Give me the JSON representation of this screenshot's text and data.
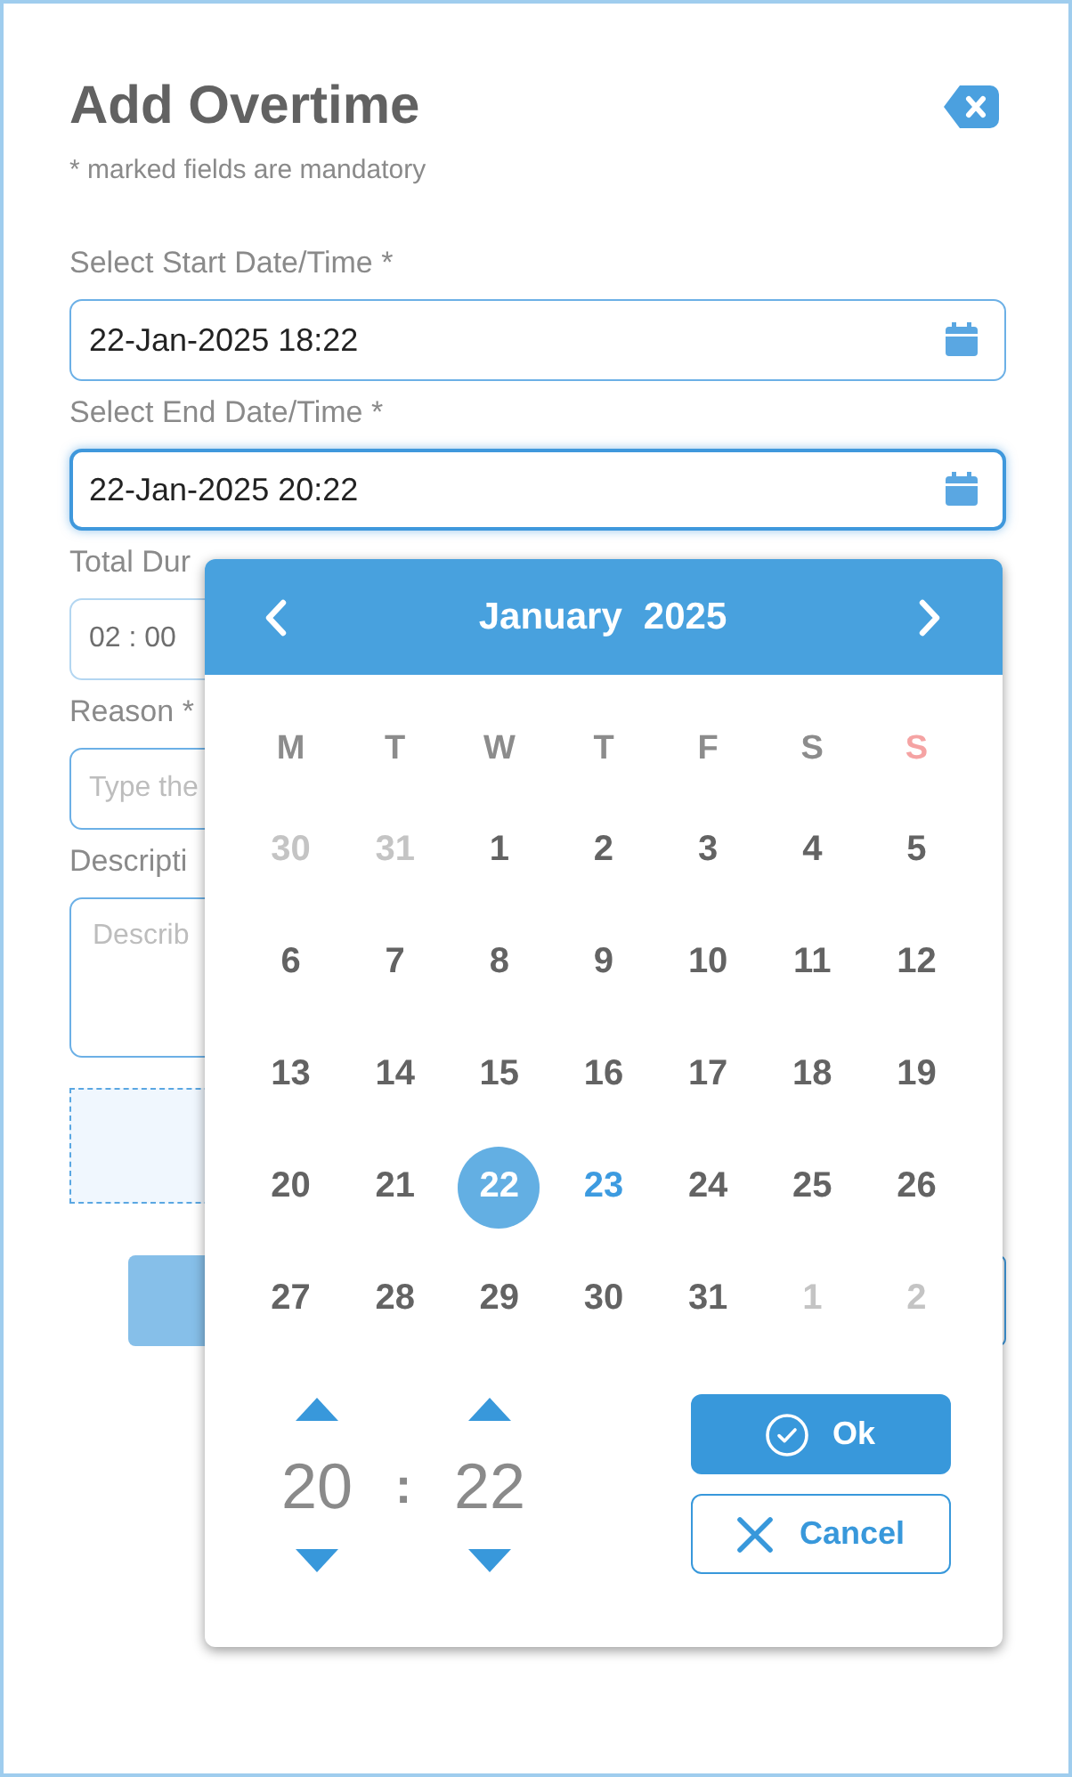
{
  "dialog": {
    "title": "Add Overtime",
    "note": "* marked fields are mandatory"
  },
  "fields": [
    {
      "kind": "date",
      "label": "Select Start Date/Time *",
      "value": "22-Jan-2025 18:22",
      "focused": false,
      "disabled": false
    },
    {
      "kind": "date",
      "label": "Select End Date/Time *",
      "value": "22-Jan-2025 20:22",
      "focused": true,
      "disabled": false
    },
    {
      "kind": "text",
      "label": "Total Dur",
      "value": "02 : 00",
      "focused": false,
      "disabled": true
    },
    {
      "kind": "text",
      "label": "Reason *",
      "placeholder": "Type the",
      "focused": false,
      "disabled": false
    },
    {
      "kind": "textarea",
      "label": "Descripti",
      "placeholder": "Describ",
      "focused": false,
      "disabled": false
    }
  ],
  "drop_zone": true,
  "buttons": [
    {
      "kind": "filled"
    },
    {
      "kind": "outline"
    }
  ],
  "date_picker": {
    "month": "January",
    "year": "2025",
    "weekdays": [
      {
        "label": "M",
        "color": "#8c8c8c"
      },
      {
        "label": "T",
        "color": "#8c8c8c"
      },
      {
        "label": "W",
        "color": "#8c8c8c"
      },
      {
        "label": "T",
        "color": "#8c8c8c"
      },
      {
        "label": "F",
        "color": "#8c8c8c"
      },
      {
        "label": "S",
        "color": "#8c8c8c"
      },
      {
        "label": "S",
        "color": "#f5a3a3"
      }
    ],
    "weeks": [
      [
        {
          "day": "30",
          "outside": true,
          "selected": false,
          "today": false
        },
        {
          "day": "31",
          "outside": true,
          "selected": false,
          "today": false
        },
        {
          "day": "1",
          "outside": false,
          "selected": false,
          "today": false
        },
        {
          "day": "2",
          "outside": false,
          "selected": false,
          "today": false
        },
        {
          "day": "3",
          "outside": false,
          "selected": false,
          "today": false
        },
        {
          "day": "4",
          "outside": false,
          "selected": false,
          "today": false
        },
        {
          "day": "5",
          "outside": false,
          "selected": false,
          "today": false
        }
      ],
      [
        {
          "day": "6",
          "outside": false,
          "selected": false,
          "today": false
        },
        {
          "day": "7",
          "outside": false,
          "selected": false,
          "today": false
        },
        {
          "day": "8",
          "outside": false,
          "selected": false,
          "today": false
        },
        {
          "day": "9",
          "outside": false,
          "selected": false,
          "today": false
        },
        {
          "day": "10",
          "outside": false,
          "selected": false,
          "today": false
        },
        {
          "day": "11",
          "outside": false,
          "selected": false,
          "today": false
        },
        {
          "day": "12",
          "outside": false,
          "selected": false,
          "today": false
        }
      ],
      [
        {
          "day": "13",
          "outside": false,
          "selected": false,
          "today": false
        },
        {
          "day": "14",
          "outside": false,
          "selected": false,
          "today": false
        },
        {
          "day": "15",
          "outside": false,
          "selected": false,
          "today": false
        },
        {
          "day": "16",
          "outside": false,
          "selected": false,
          "today": false
        },
        {
          "day": "17",
          "outside": false,
          "selected": false,
          "today": false
        },
        {
          "day": "18",
          "outside": false,
          "selected": false,
          "today": false
        },
        {
          "day": "19",
          "outside": false,
          "selected": false,
          "today": false
        }
      ],
      [
        {
          "day": "20",
          "outside": false,
          "selected": false,
          "today": false
        },
        {
          "day": "21",
          "outside": false,
          "selected": false,
          "today": false
        },
        {
          "day": "22",
          "outside": false,
          "selected": true,
          "today": false
        },
        {
          "day": "23",
          "outside": false,
          "selected": false,
          "today": true
        },
        {
          "day": "24",
          "outside": false,
          "selected": false,
          "today": false
        },
        {
          "day": "25",
          "outside": false,
          "selected": false,
          "today": false
        },
        {
          "day": "26",
          "outside": false,
          "selected": false,
          "today": false
        }
      ],
      [
        {
          "day": "27",
          "outside": false,
          "selected": false,
          "today": false
        },
        {
          "day": "28",
          "outside": false,
          "selected": false,
          "today": false
        },
        {
          "day": "29",
          "outside": false,
          "selected": false,
          "today": false
        },
        {
          "day": "30",
          "outside": false,
          "selected": false,
          "today": false
        },
        {
          "day": "31",
          "outside": false,
          "selected": false,
          "today": false
        },
        {
          "day": "1",
          "outside": true,
          "selected": false,
          "today": false
        },
        {
          "day": "2",
          "outside": true,
          "selected": false,
          "today": false
        }
      ]
    ],
    "time": {
      "hour": "20",
      "separator": ":",
      "minute": "22"
    },
    "actions": [
      {
        "kind": "confirm",
        "label": "Ok"
      },
      {
        "kind": "cancel",
        "label": "Cancel"
      }
    ]
  }
}
